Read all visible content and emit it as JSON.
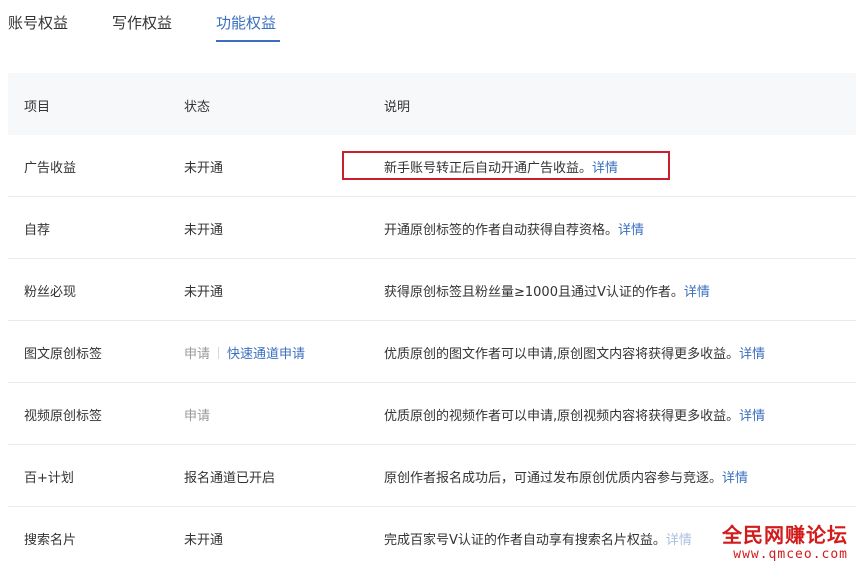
{
  "tabs": [
    {
      "label": "账号权益",
      "active": false
    },
    {
      "label": "写作权益",
      "active": false
    },
    {
      "label": "功能权益",
      "active": true
    }
  ],
  "table": {
    "headers": [
      "项目",
      "状态",
      "说明"
    ],
    "rows": [
      {
        "item": "广告收益",
        "status": "未开通",
        "desc": "新手账号转正后自动开通广告收益。",
        "link": "详情"
      },
      {
        "item": "自荐",
        "status": "未开通",
        "desc": "开通原创标签的作者自动获得自荐资格。",
        "link": "详情"
      },
      {
        "item": "粉丝必现",
        "status": "未开通",
        "desc": "获得原创标签且粉丝量≥1000且通过V认证的作者。",
        "link": "详情"
      },
      {
        "item": "图文原创标签",
        "status": "申请",
        "status_link": "快速通道申请",
        "desc": "优质原创的图文作者可以申请,原创图文内容将获得更多收益。",
        "link": "详情"
      },
      {
        "item": "视频原创标签",
        "status": "申请",
        "desc": "优质原创的视频作者可以申请,原创视频内容将获得更多收益。",
        "link": "详情"
      },
      {
        "item": "百+计划",
        "status": "报名通道已开启",
        "desc": "原创作者报名成功后，可通过发布原创优质内容参与竞逐。",
        "link": "详情"
      },
      {
        "item": "搜索名片",
        "status": "未开通",
        "desc": "完成百家号V认证的作者自动享有搜索名片权益。",
        "link": "详情"
      }
    ]
  },
  "watermark": {
    "title": "全民网赚论坛",
    "url": "www.qmceo.com"
  },
  "colors": {
    "accent": "#3b6fc0",
    "highlight": "#c8202f",
    "watermark": "#d21b1b"
  }
}
